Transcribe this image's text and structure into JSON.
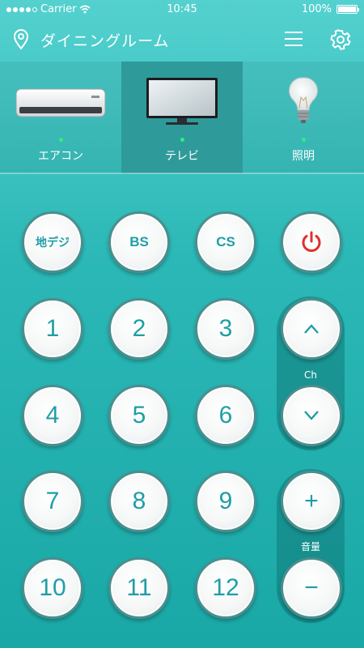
{
  "status": {
    "carrier": "Carrier",
    "time": "10:45",
    "battery": "100%"
  },
  "header": {
    "title": "ダイニングルーム"
  },
  "tabs": [
    {
      "label": "エアコン",
      "icon": "air-conditioner"
    },
    {
      "label": "テレビ",
      "icon": "television",
      "active": true
    },
    {
      "label": "照明",
      "icon": "light-bulb"
    }
  ],
  "buttons": {
    "terrestrial": "地デジ",
    "bs": "BS",
    "cs": "CS",
    "n1": "1",
    "n2": "2",
    "n3": "3",
    "n4": "4",
    "n5": "5",
    "n6": "6",
    "n7": "7",
    "n8": "8",
    "n9": "9",
    "n10": "10",
    "n11": "11",
    "n12": "12",
    "ch_up": "^",
    "ch_down": "v",
    "vol_up": "+",
    "vol_down": "−"
  },
  "labels": {
    "channel": "Ch",
    "volume": "音量"
  },
  "colors": {
    "accent": "#1e9ea6",
    "power": "#e0302e",
    "led": "#2bf07a"
  }
}
